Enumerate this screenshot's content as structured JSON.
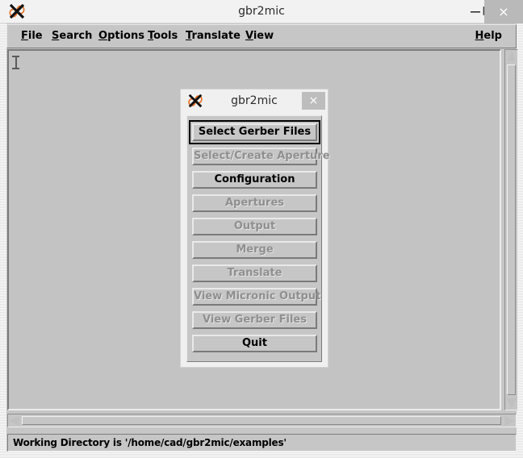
{
  "window": {
    "title": "gbr2mic",
    "icon": "x-logo-icon",
    "controls": {
      "minimize": "minimize-icon",
      "maximize": "maximize-icon",
      "close": "×"
    }
  },
  "menubar": {
    "items": [
      {
        "label": "File",
        "mnemonic": "F"
      },
      {
        "label": "Search",
        "mnemonic": "S"
      },
      {
        "label": "Options",
        "mnemonic": "O"
      },
      {
        "label": "Tools",
        "mnemonic": "T"
      },
      {
        "label": "Translate",
        "mnemonic": "T"
      },
      {
        "label": "View",
        "mnemonic": "V"
      }
    ],
    "help": {
      "label": "Help",
      "mnemonic": "H"
    }
  },
  "textarea": {
    "value": "",
    "caret": "text-caret"
  },
  "statusbar": {
    "text": "Working Directory is '/home/cad/gbr2mic/examples'"
  },
  "dialog": {
    "title": "gbr2mic",
    "icon": "x-logo-icon",
    "close_label": "×",
    "buttons": [
      {
        "label": "Select Gerber Files",
        "enabled": true,
        "focused": true
      },
      {
        "label": "Select/Create Aperture",
        "enabled": false,
        "focused": false
      },
      {
        "label": "Configuration",
        "enabled": true,
        "focused": false
      },
      {
        "label": "Apertures",
        "enabled": false,
        "focused": false
      },
      {
        "label": "Output",
        "enabled": false,
        "focused": false
      },
      {
        "label": "Merge",
        "enabled": false,
        "focused": false
      },
      {
        "label": "Translate",
        "enabled": false,
        "focused": false
      },
      {
        "label": "View Micronic Output",
        "enabled": false,
        "focused": false
      },
      {
        "label": "View Gerber Files",
        "enabled": false,
        "focused": false
      },
      {
        "label": "Quit",
        "enabled": true,
        "focused": false
      }
    ]
  },
  "colors": {
    "face": "#c6c6c6",
    "titlebar": "#f0f0f0",
    "text": "#000000",
    "disabled_text": "#8f8f8f",
    "shadow": "#7a7a7a",
    "highlight": "#e9e9e9"
  }
}
